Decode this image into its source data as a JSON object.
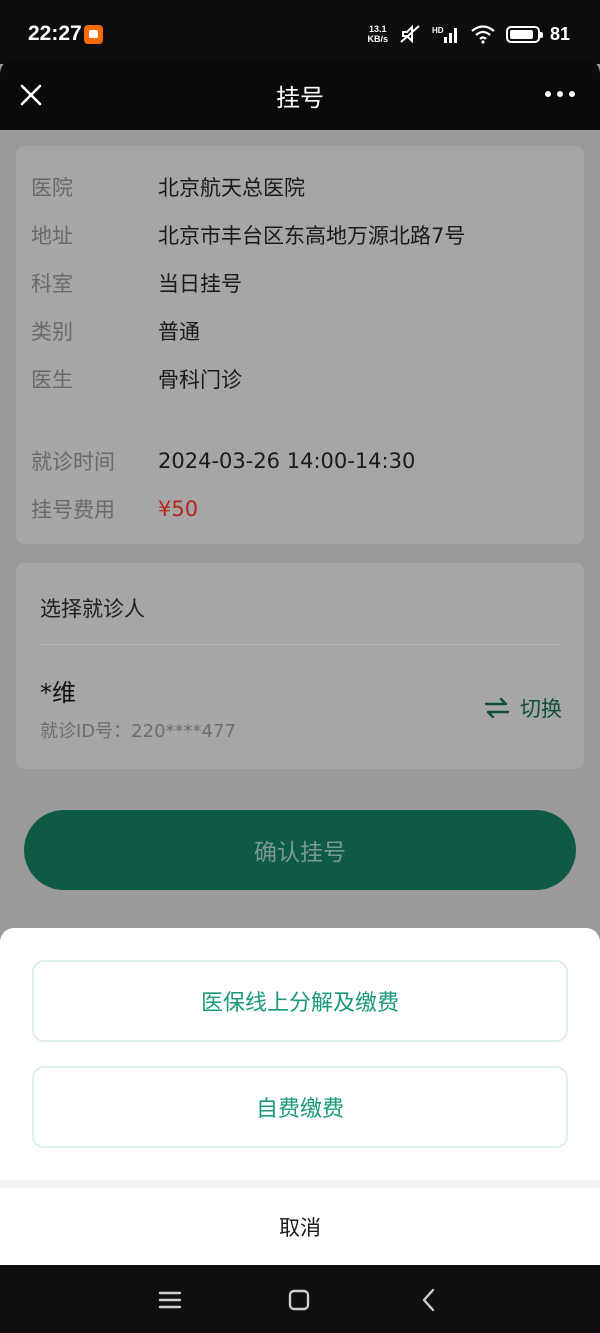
{
  "status_bar": {
    "time": "22:27",
    "net_speed_value": "13.1",
    "net_speed_unit": "KB/s",
    "battery_percent": "81"
  },
  "header": {
    "title": "挂号"
  },
  "info": {
    "rows": [
      {
        "label": "医院",
        "value": "北京航天总医院"
      },
      {
        "label": "地址",
        "value": "北京市丰台区东高地万源北路7号"
      },
      {
        "label": "科室",
        "value": "当日挂号"
      },
      {
        "label": "类别",
        "value": "普通"
      },
      {
        "label": "医生",
        "value": "骨科门诊"
      }
    ],
    "time_label": "就诊时间",
    "time_value": "2024-03-26 14:00-14:30",
    "fee_label": "挂号费用",
    "fee_value": "¥50"
  },
  "patient": {
    "section_title": "选择就诊人",
    "name": "*维",
    "id_text": "就诊ID号：220****477",
    "switch_label": "切换"
  },
  "confirm_label": "确认挂号",
  "sheet": {
    "option1": "医保线上分解及缴费",
    "option2": "自费缴费",
    "cancel": "取消"
  },
  "colors": {
    "accent": "#1a9a7a",
    "price": "#e0352b",
    "primary_button": "#1a8a6e"
  },
  "icons": {
    "close": "close-icon",
    "more": "more-icon",
    "switch": "swap-arrows-icon",
    "nav_menu": "menu-icon",
    "nav_home": "home-icon",
    "nav_back": "back-icon"
  }
}
